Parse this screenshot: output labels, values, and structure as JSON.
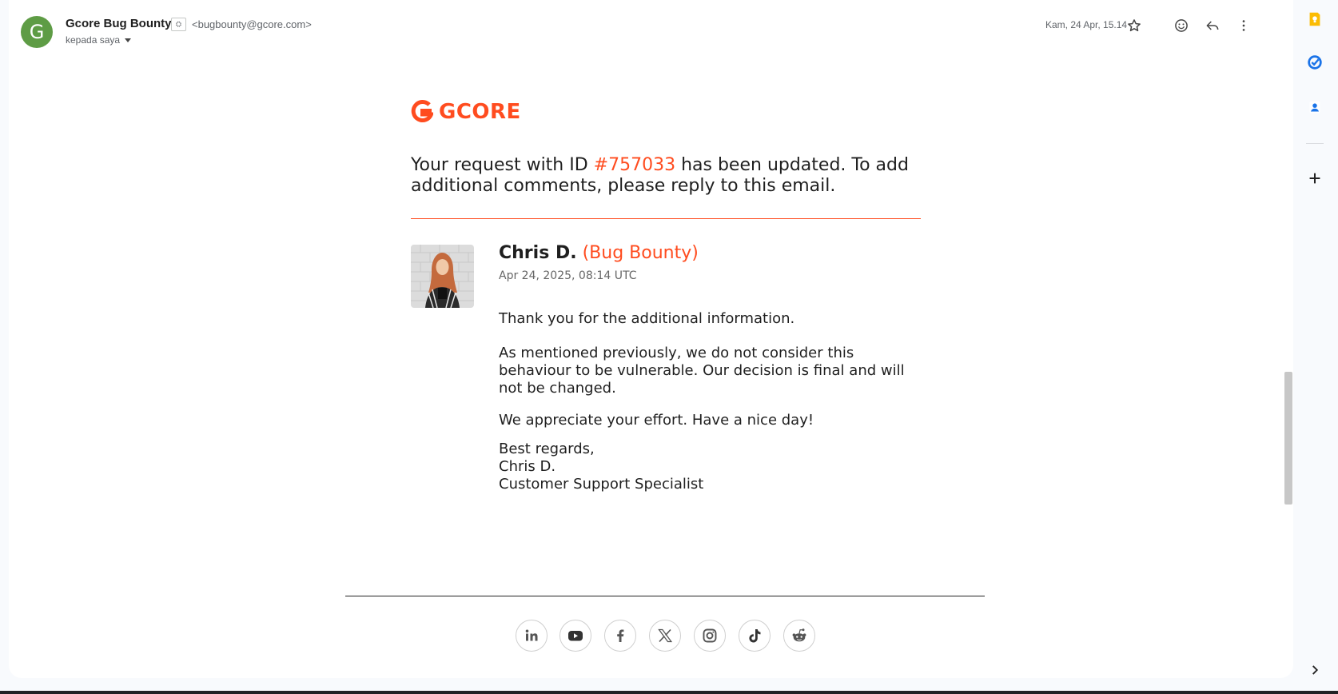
{
  "header": {
    "avatar_letter": "G",
    "sender_name": "Gcore Bug Bounty",
    "sender_badge": "⛭",
    "sender_email": "<bugbounty@gcore.com>",
    "recipient": "kepada saya",
    "date": "Kam, 24 Apr, 15.14",
    "icons": [
      "star-icon",
      "emoji-icon",
      "reply-icon",
      "more-vert-icon"
    ]
  },
  "side_rail": {
    "icons": [
      "keep-icon",
      "tasks-icon",
      "contacts-icon",
      "add-icon",
      "chevron-right-icon"
    ]
  },
  "email": {
    "logo_text": "GCORE",
    "headline_before": "Your request with ID ",
    "ticket_id": "#757033",
    "headline_after": " has been updated. To add additional comments, please reply to this email.",
    "agent_name": "Chris D.",
    "agent_role": "(Bug Bounty)",
    "agent_date": "Apr 24, 2025, 08:14 UTC",
    "message_paragraphs": [
      "Thank you for the additional information.",
      "As mentioned previously, we do not consider this behaviour to be vulnerable. Our decision is final and will not be changed.",
      "We appreciate your effort. Have a nice day!"
    ],
    "signature": "Best regards,\nChris D.\nCustomer Support Specialist"
  },
  "social_links": [
    "linkedin-icon",
    "youtube-icon",
    "facebook-icon",
    "x-icon",
    "instagram-icon",
    "tiktok-icon",
    "reddit-icon"
  ],
  "colors": {
    "brand": "#ff4c1f",
    "avatar": "#5e9c45",
    "text": "#1f1f1f"
  }
}
